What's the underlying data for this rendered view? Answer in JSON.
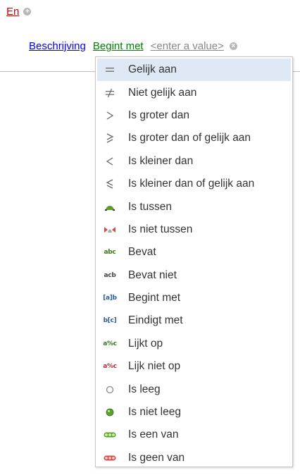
{
  "group": {
    "operator": "En",
    "add_symbol": "+"
  },
  "condition": {
    "field": "Beschrijving",
    "operator": "Begint met",
    "value_placeholder": "<enter a value>",
    "clear_symbol": "×"
  },
  "colors": {
    "group_operator": "#cc0000",
    "field": "#0000ee",
    "operator": "#008000",
    "selected": "#dfe9f5"
  },
  "menu": {
    "selected_index": 0,
    "items": [
      {
        "label": "Gelijk aan",
        "icon": "equals-icon"
      },
      {
        "label": "Niet gelijk aan",
        "icon": "not-equals-icon"
      },
      {
        "label": "Is groter dan",
        "icon": "greater-than-icon"
      },
      {
        "label": "Is groter dan of gelijk aan",
        "icon": "greater-or-equal-icon"
      },
      {
        "label": "Is kleiner dan",
        "icon": "less-than-icon"
      },
      {
        "label": "Is kleiner dan of gelijk aan",
        "icon": "less-or-equal-icon"
      },
      {
        "label": "Is tussen",
        "icon": "between-icon"
      },
      {
        "label": "Is niet tussen",
        "icon": "not-between-icon"
      },
      {
        "label": "Bevat",
        "icon": "contains-icon",
        "icon_text": "abc"
      },
      {
        "label": "Bevat niet",
        "icon": "not-contains-icon",
        "icon_text": "acb"
      },
      {
        "label": "Begint met",
        "icon": "begins-with-icon",
        "icon_text": "[a]b"
      },
      {
        "label": "Eindigt met",
        "icon": "ends-with-icon",
        "icon_text": "b[c]"
      },
      {
        "label": "Lijkt op",
        "icon": "like-icon",
        "icon_text": "a%c"
      },
      {
        "label": "Lijk niet op",
        "icon": "not-like-icon",
        "icon_text": "a%c"
      },
      {
        "label": "Is leeg",
        "icon": "is-empty-icon"
      },
      {
        "label": "Is niet leeg",
        "icon": "is-not-empty-icon"
      },
      {
        "label": "Is een van",
        "icon": "any-of-icon"
      },
      {
        "label": "Is geen van",
        "icon": "none-of-icon"
      }
    ]
  }
}
